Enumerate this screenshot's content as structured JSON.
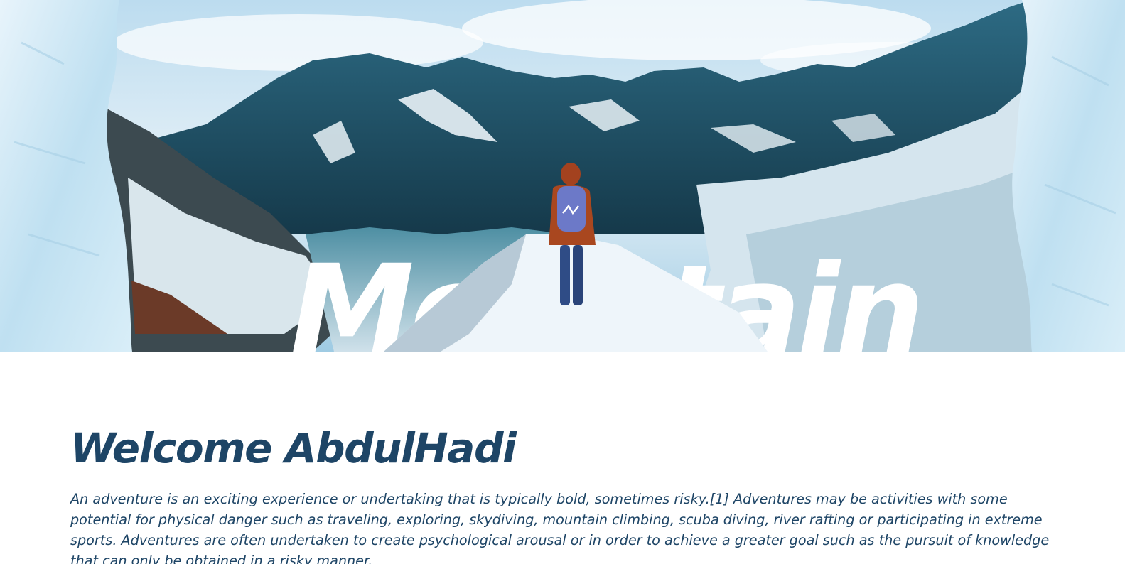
{
  "hero": {
    "word": "Mountain",
    "image_description_icon": "mountain-hiker-image"
  },
  "welcome": {
    "title": "Welcome AbdulHadi",
    "paragraph": "An adventure is an exciting experience or undertaking that is typically bold, sometimes risky.[1] Adventures may be activities with some potential for physical danger such as traveling, exploring, skydiving, mountain climbing, scuba diving, river rafting or participating in extreme sports. Adventures are often undertaken to create psychological arousal or in order to achieve a greater goal such as the pursuit of knowledge that can only be obtained in a risky manner."
  },
  "colors": {
    "heading": "#1e4566",
    "ice": "#cfe6f2",
    "sky": "#8ec3e2",
    "mountain_dark": "#1f4f63"
  }
}
